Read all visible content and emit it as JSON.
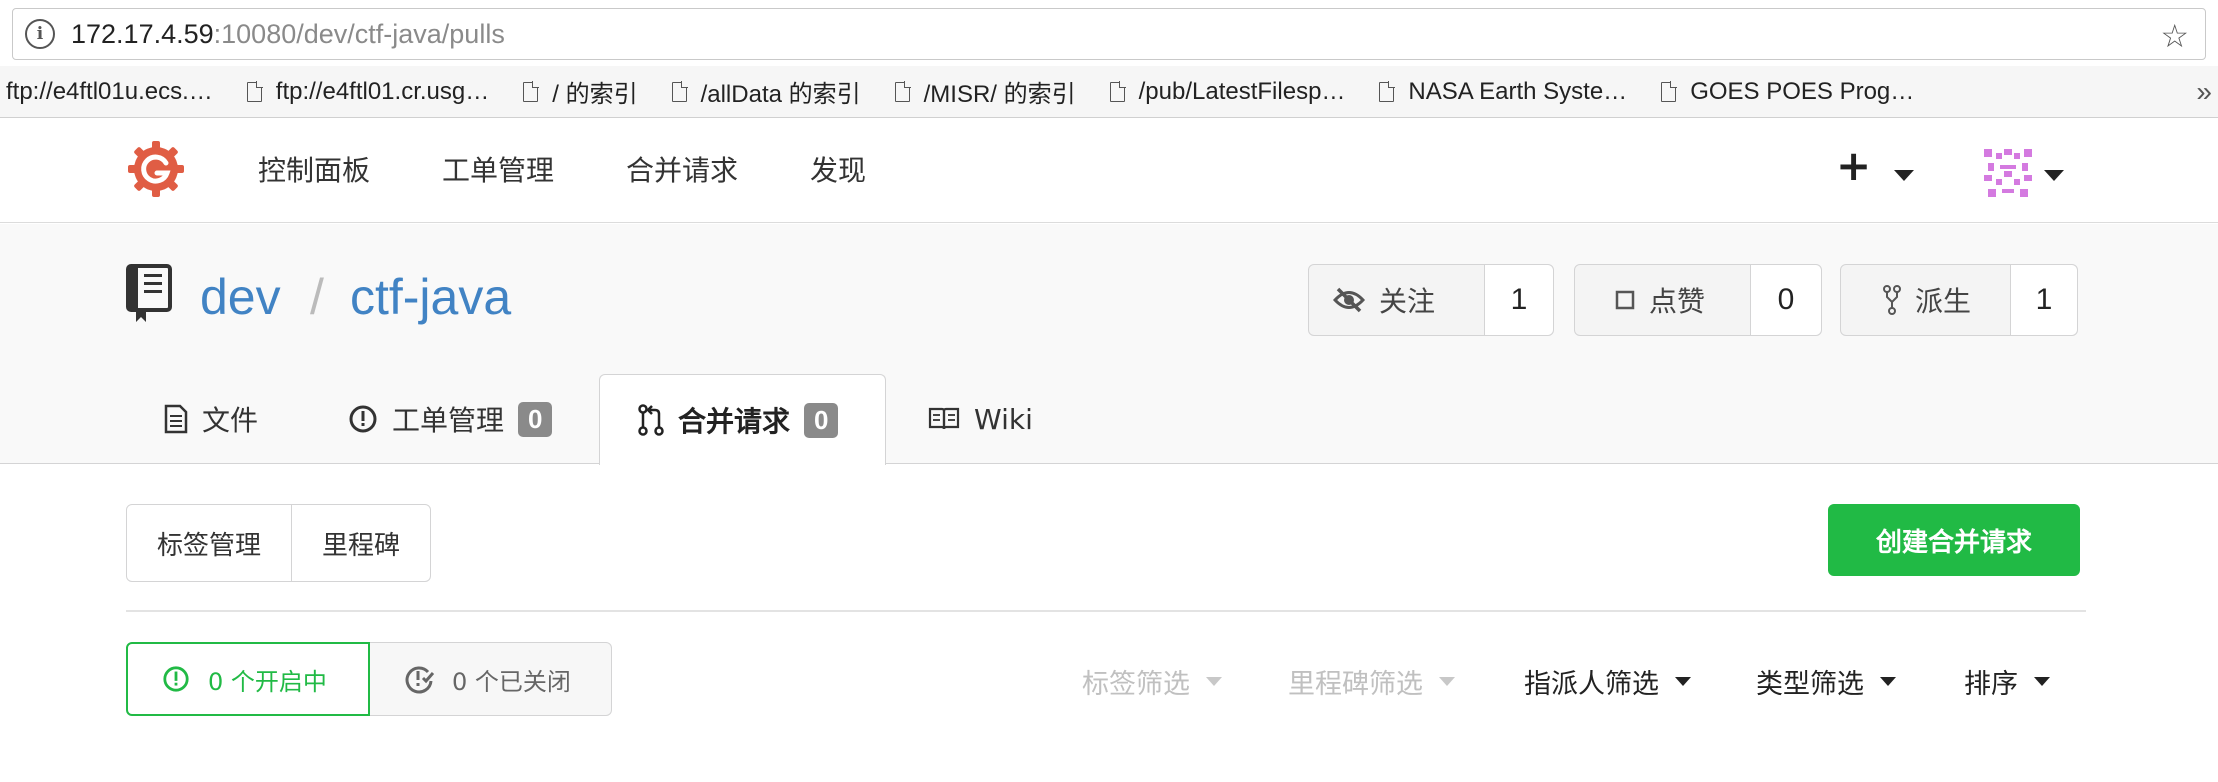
{
  "browser": {
    "url_host": "172.17.4.59",
    "url_rest": ":10080/dev/ctf-java/pulls",
    "bookmarks": [
      "ftp://e4ftl01u.ecs.…",
      "ftp://e4ftl01.cr.usg…",
      "/ 的索引",
      "/allData 的索引",
      "/MISR/ 的索引",
      "/pub/LatestFilesp…",
      "NASA Earth Syste…",
      "GOES POES Prog…"
    ],
    "more": "»"
  },
  "nav": {
    "dashboard": "控制面板",
    "issues": "工单管理",
    "pulls": "合并请求",
    "explore": "发现",
    "plus": "+"
  },
  "repo": {
    "owner": "dev",
    "separator": "/",
    "name": "ctf-java",
    "watch_label": "关注",
    "watch_count": "1",
    "star_label": "点赞",
    "star_count": "0",
    "fork_label": "派生",
    "fork_count": "1"
  },
  "tabs": {
    "files": "文件",
    "issues": "工单管理",
    "issues_count": "0",
    "pulls": "合并请求",
    "pulls_count": "0",
    "wiki": "Wiki"
  },
  "main": {
    "labels_btn": "标签管理",
    "milestones_btn": "里程碑",
    "create_btn": "创建合并请求",
    "open_state": "0 个开启中",
    "closed_state": "0 个已关闭",
    "filter_label": "标签筛选",
    "filter_milestone": "里程碑筛选",
    "filter_assignee": "指派人筛选",
    "filter_type": "类型筛选",
    "sort": "排序"
  },
  "colors": {
    "accent_blue": "#4183c4",
    "green": "#21ba45",
    "logo_red": "#e05d44"
  },
  "icons": {
    "info": "info-icon",
    "star": "bookmark-star-icon",
    "file": "file-icon",
    "logo": "gogs-logo",
    "repo": "repo-book-icon",
    "watch": "eye-slash-icon",
    "stargazer": "star-square-icon",
    "fork": "fork-icon",
    "issue": "issue-opened-icon",
    "pull": "git-pull-request-icon",
    "wiki": "book-icon",
    "closed": "issue-closed-icon"
  }
}
